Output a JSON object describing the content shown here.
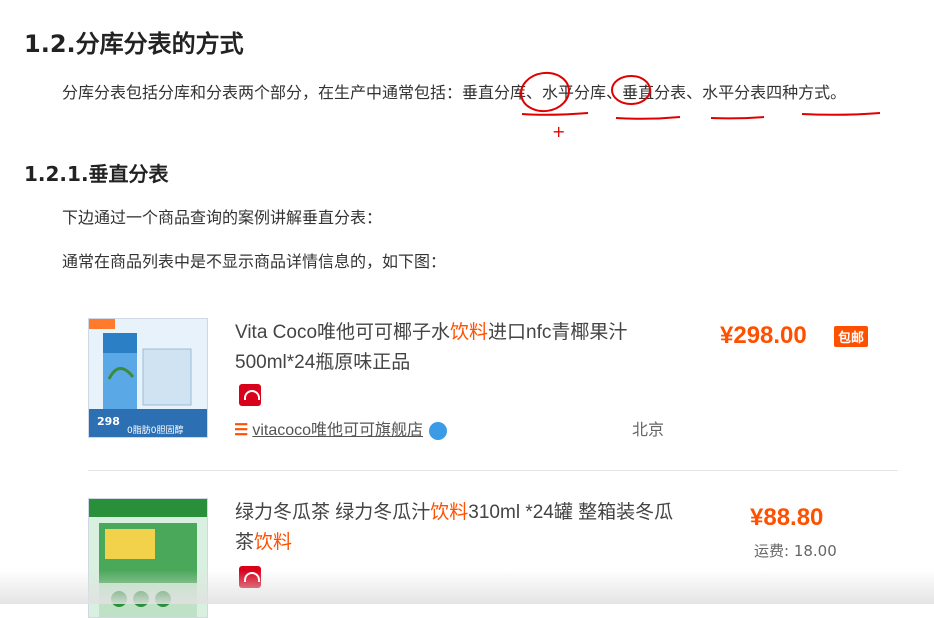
{
  "heading_main": "1.2.分库分表的方式",
  "paragraph1": {
    "prefix": "分库分表包括分库和分表两个部分，在生产中通常包括：",
    "term1": "垂直分库",
    "sep1": "、",
    "term2": "水平分库",
    "sep2": "、",
    "term3": "垂直分表",
    "sep3": "、",
    "term4": "水平分表",
    "suffix": "四种方式。"
  },
  "heading_sub": "1.2.1.垂直分表",
  "paragraph2": "下边通过一个商品查询的案例讲解垂直分表：",
  "paragraph3": "通常在商品列表中是不显示商品详情信息的，如下图：",
  "annotation_plus": "+",
  "products": [
    {
      "title_parts": [
        "Vita Coco唯他可可椰子水",
        "饮料",
        "进口nfc青椰果汁500ml*24瓶原味正品"
      ],
      "price": "¥298.00",
      "badge": "包邮",
      "store": "vitacoco唯他可可旗舰店",
      "location": "北京",
      "thumb_price": "298",
      "thumb_text": "0脂肪0胆固醇"
    },
    {
      "title_parts": [
        "绿力冬瓜茶 绿力冬瓜汁",
        "饮料",
        "310ml *24罐 整箱装冬瓜茶",
        "饮料"
      ],
      "price": "¥88.80",
      "shipping": "运费: 18.00"
    }
  ],
  "colors": {
    "accent": "#ff5000",
    "annotation": "#e00000"
  }
}
